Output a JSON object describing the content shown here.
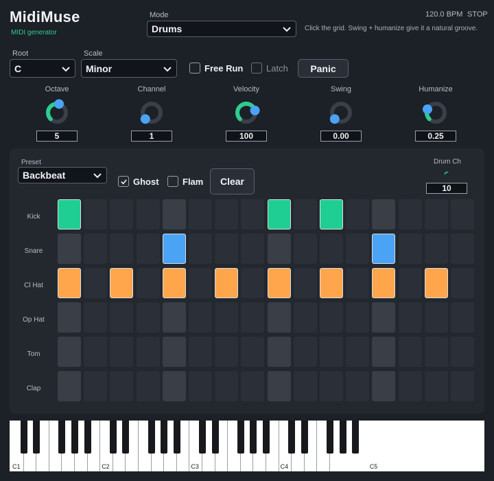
{
  "app": {
    "title": "MidiMuse",
    "subtitle": "MIDI generator"
  },
  "mode": {
    "label": "Mode",
    "value": "Drums"
  },
  "transport": {
    "bpm": "120.0 BPM",
    "state": "STOP"
  },
  "hint": "Click the grid. Swing + humanize give it a natural groove.",
  "root": {
    "label": "Root",
    "value": "C"
  },
  "scale": {
    "label": "Scale",
    "value": "Minor"
  },
  "free_run": {
    "label": "Free Run",
    "checked": false
  },
  "latch": {
    "label": "Latch",
    "checked": false
  },
  "panic_label": "Panic",
  "knobs": [
    {
      "label": "Octave",
      "value": "5",
      "level": 0.55
    },
    {
      "label": "Channel",
      "value": "1",
      "level": 0.0
    },
    {
      "label": "Velocity",
      "value": "100",
      "level": 0.78
    },
    {
      "label": "Swing",
      "value": "0.00",
      "level": 0.0
    },
    {
      "label": "Humanize",
      "value": "0.25",
      "level": 0.25
    }
  ],
  "preset": {
    "label": "Preset",
    "value": "Backbeat"
  },
  "ghost": {
    "label": "Ghost",
    "checked": true
  },
  "flam": {
    "label": "Flam",
    "checked": false
  },
  "clear_label": "Clear",
  "drum_ch": {
    "label": "Drum Ch",
    "value": "10"
  },
  "colors": {
    "kick": "#1fce92",
    "snare": "#4aa3f5",
    "hat": "#ffa64d",
    "accent": "#2ecc8f"
  },
  "grid": {
    "steps": 16,
    "rows": [
      {
        "name": "Kick",
        "color": "kick",
        "steps": [
          1,
          0,
          0,
          0,
          0,
          0,
          0,
          0,
          1,
          0,
          1,
          0,
          0,
          0,
          0,
          0
        ]
      },
      {
        "name": "Snare",
        "color": "snare",
        "steps": [
          0,
          0,
          0,
          0,
          1,
          0,
          0,
          0,
          0,
          0,
          0,
          0,
          1,
          0,
          0,
          0
        ]
      },
      {
        "name": "Cl Hat",
        "color": "hat",
        "steps": [
          1,
          0,
          1,
          0,
          1,
          0,
          1,
          0,
          1,
          0,
          1,
          0,
          1,
          0,
          1,
          0
        ]
      },
      {
        "name": "Op Hat",
        "color": "hat",
        "steps": [
          0,
          0,
          0,
          0,
          0,
          0,
          0,
          0,
          0,
          0,
          0,
          0,
          0,
          0,
          0,
          0
        ]
      },
      {
        "name": "Tom",
        "color": "hat",
        "steps": [
          0,
          0,
          0,
          0,
          0,
          0,
          0,
          0,
          0,
          0,
          0,
          0,
          0,
          0,
          0,
          0
        ]
      },
      {
        "name": "Clap",
        "color": "hat",
        "steps": [
          0,
          0,
          0,
          0,
          0,
          0,
          0,
          0,
          0,
          0,
          0,
          0,
          0,
          0,
          0,
          0
        ]
      }
    ]
  },
  "keyboard": {
    "octave_labels": [
      "C1",
      "C2",
      "C3",
      "C4",
      "C5"
    ]
  }
}
